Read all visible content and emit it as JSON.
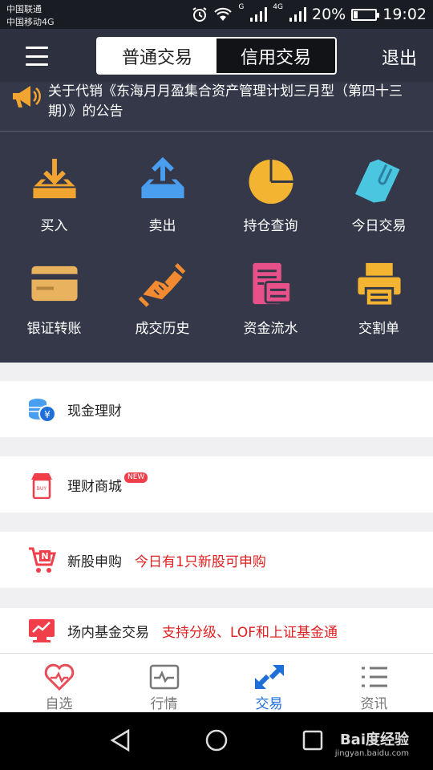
{
  "status_bar": {
    "carrier_1": "中国联通",
    "carrier_2": "中国移动4G",
    "battery": "20%",
    "battery_level": 0.2,
    "time": "19:02",
    "net_g": "G",
    "net_4g": "4G"
  },
  "header": {
    "tabs": [
      {
        "label": "普通交易",
        "active": true
      },
      {
        "label": "信用交易",
        "active": false
      }
    ],
    "logout_label": "退出"
  },
  "notice": {
    "text": "关于代销《东海月月盈集合资产管理计划三月型（第四十三期）》的公告"
  },
  "functions": [
    {
      "label": "买入",
      "icon": "buy-download-icon"
    },
    {
      "label": "卖出",
      "icon": "sell-upload-icon"
    },
    {
      "label": "持仓查询",
      "icon": "pie-chart-icon"
    },
    {
      "label": "今日交易",
      "icon": "paperclip-icon"
    },
    {
      "label": "银证转账",
      "icon": "bank-card-icon"
    },
    {
      "label": "成交历史",
      "icon": "handshake-icon"
    },
    {
      "label": "资金流水",
      "icon": "ledger-icon"
    },
    {
      "label": "交割单",
      "icon": "printer-icon"
    }
  ],
  "list": {
    "items": [
      {
        "label": "现金理财",
        "sub": "",
        "icon": "cash-coins-icon"
      },
      {
        "label": "理财商城",
        "sub": "",
        "badge": "NEW",
        "icon": "shop-icon"
      },
      {
        "label": "新股申购",
        "sub": "今日有1只新股可申购",
        "icon": "cart-icon"
      },
      {
        "label": "场内基金交易",
        "sub": "支持分级、LOF和上证基金通",
        "icon": "monitor-chart-icon"
      }
    ]
  },
  "tabbar": {
    "tabs": [
      {
        "label": "自选",
        "icon": "heart-icon"
      },
      {
        "label": "行情",
        "icon": "pulse-icon"
      },
      {
        "label": "交易",
        "icon": "exchange-arrows-icon",
        "active": true
      },
      {
        "label": "资讯",
        "icon": "list-icon"
      }
    ]
  },
  "watermark": {
    "brand": "Bai度经验",
    "url": "jingyan.baidu.com"
  },
  "colors": {
    "header_bg": "#2d313f",
    "panel_bg": "#343848",
    "accent_blue": "#1e6fd8",
    "alert_red": "#e02020",
    "orange": "#f2a431"
  }
}
